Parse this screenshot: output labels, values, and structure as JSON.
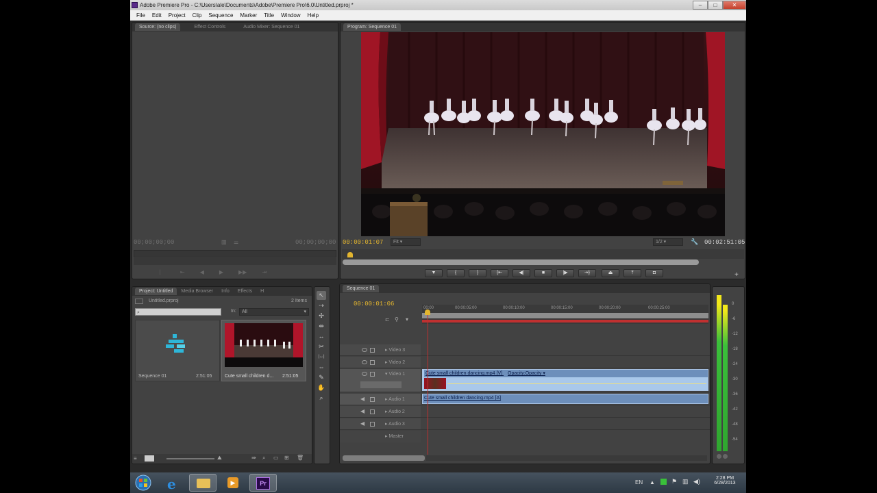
{
  "window": {
    "title": "Adobe Premiere Pro - C:\\Users\\ale\\Documents\\Adobe\\Premiere Pro\\6.0\\Untitled.prproj *"
  },
  "menu": [
    "File",
    "Edit",
    "Project",
    "Clip",
    "Sequence",
    "Marker",
    "Title",
    "Window",
    "Help"
  ],
  "source_panel": {
    "tabs": [
      "Source: (no clips)",
      "Effect Controls",
      "Audio Mixer: Sequence 01"
    ],
    "tc_in": "00;00;00;00",
    "tc_out": "00;00;00;00"
  },
  "program_panel": {
    "tab": "Program: Sequence 01",
    "timecode": "00:00:01:07",
    "fit": "Fit",
    "zoom": "1/2",
    "duration": "00:02:51:05",
    "playhead_fraction": 0.02
  },
  "project_panel": {
    "tabs": [
      "Project: Untitled",
      "Media Browser",
      "Info",
      "Effects",
      "H"
    ],
    "filename": "Untitled.prproj",
    "item_count": "2 Items",
    "search_placeholder": "",
    "in_label": "In:",
    "in_value": "All",
    "items": [
      {
        "name": "Sequence 01",
        "duration": "2:51:05"
      },
      {
        "name": "Cute small children d...",
        "duration": "2:51:05"
      }
    ]
  },
  "timeline": {
    "tab": "Sequence 01",
    "timecode": "00:00:01:06",
    "ruler": [
      "00:00",
      "00:00:05:00",
      "00:00:10:00",
      "00:00:15:00",
      "00:00:20:00",
      "00:00:25:00"
    ],
    "tracks": [
      "Video 3",
      "Video 2",
      "Video 1",
      "Audio 1",
      "Audio 2",
      "Audio 3",
      "Master"
    ],
    "video_clip": "Cute small children dancing.mp4 [V]",
    "video_effect": "Opacity:Opacity",
    "audio_clip": "Cute small children dancing.mp4 [A]"
  },
  "meter": {
    "labels": [
      "0",
      "-6",
      "-12",
      "-18",
      "-24",
      "-30",
      "-36",
      "-42",
      "-48",
      "-54"
    ]
  },
  "taskbar": {
    "lang": "EN",
    "time": "2:28 PM",
    "date": "6/28/2013"
  },
  "colors": {
    "accent_timecode": "#e3b52f",
    "clip_blue": "#7fa0c8",
    "playhead_red": "#c03030"
  },
  "icons": [
    "ie-icon",
    "folder-icon",
    "media-player-icon",
    "premiere-icon",
    "windows-start-icon"
  ]
}
